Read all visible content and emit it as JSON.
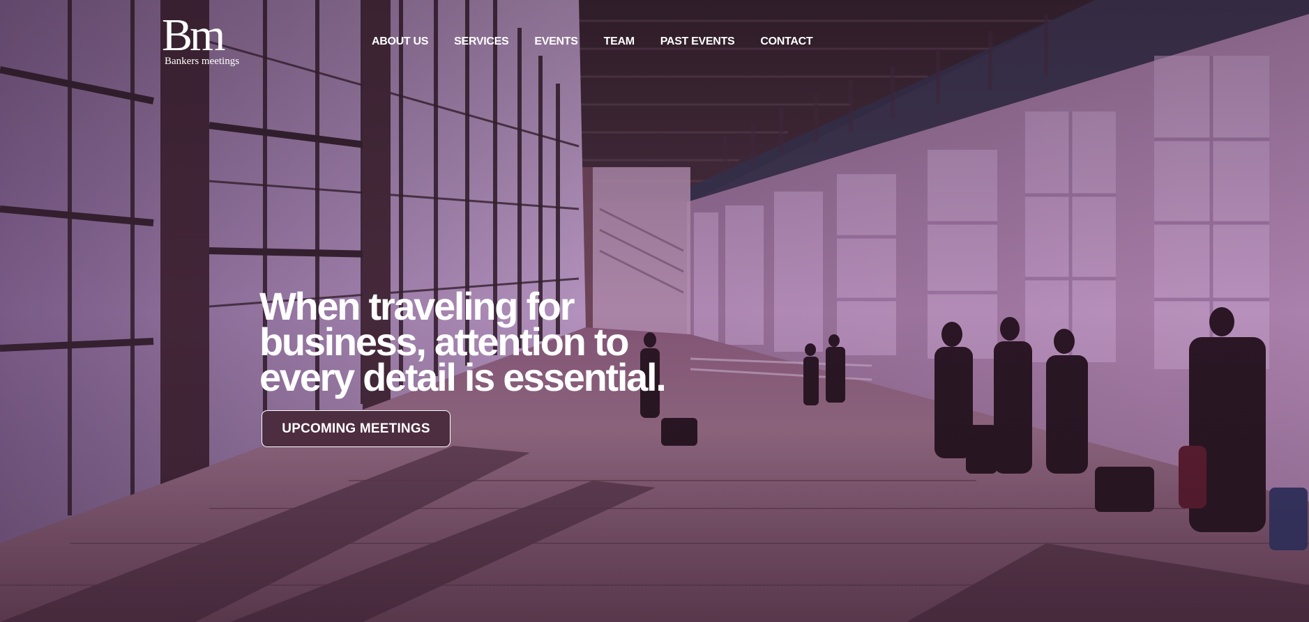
{
  "brand": {
    "logo_mark": "Bm",
    "logo_text": "Bankers meetings"
  },
  "nav": {
    "items": [
      {
        "label": "ABOUT US"
      },
      {
        "label": "SERVICES"
      },
      {
        "label": "EVENTS"
      },
      {
        "label": "TEAM"
      },
      {
        "label": "PAST EVENTS"
      },
      {
        "label": "CONTACT"
      }
    ]
  },
  "hero": {
    "headline": "When traveling for business, attention to every detail is essential.",
    "cta_label": "UPCOMING MEETINGS",
    "background_alt": "Airport terminal corridor with travelers walking with luggage",
    "overlay_color": "#6a2f5c",
    "cta_color": "#4d2d40"
  }
}
